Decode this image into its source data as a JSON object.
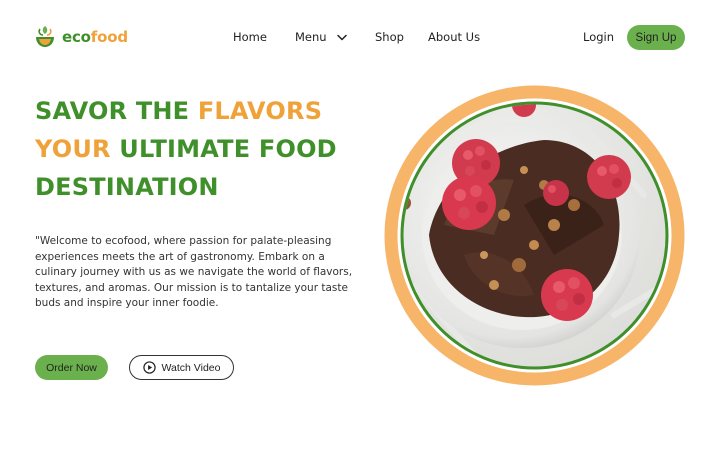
{
  "brand": {
    "name_part1": "eco",
    "name_part2": "food"
  },
  "nav": {
    "home": "Home",
    "menu": "Menu",
    "shop": "Shop",
    "about": "About Us"
  },
  "auth": {
    "login": "Login",
    "signup": "Sign Up"
  },
  "hero": {
    "title_line1_a": "SAVOR THE ",
    "title_line1_b": "FLAVORS",
    "title_line2_a": "YOUR ",
    "title_line2_b": "ULTIMATE FOOD",
    "title_line3": "DESTINATION",
    "description": "\"Welcome to ecofood, where passion for palate-pleasing experiences meets the art of gastronomy. Embark on a culinary journey with us as we navigate the world of flavors, textures, and aromas. Our mission is to tantalize your taste buds and inspire your inner foodie.",
    "order_button": "Order Now",
    "watch_button": "Watch Video"
  },
  "colors": {
    "brand_green": "#3f8f2a",
    "brand_orange": "#f0a23a",
    "button_green": "#6ab04c"
  },
  "icons": [
    "salad-bowl-logo-icon",
    "chevron-down-icon",
    "play-circle-icon"
  ]
}
